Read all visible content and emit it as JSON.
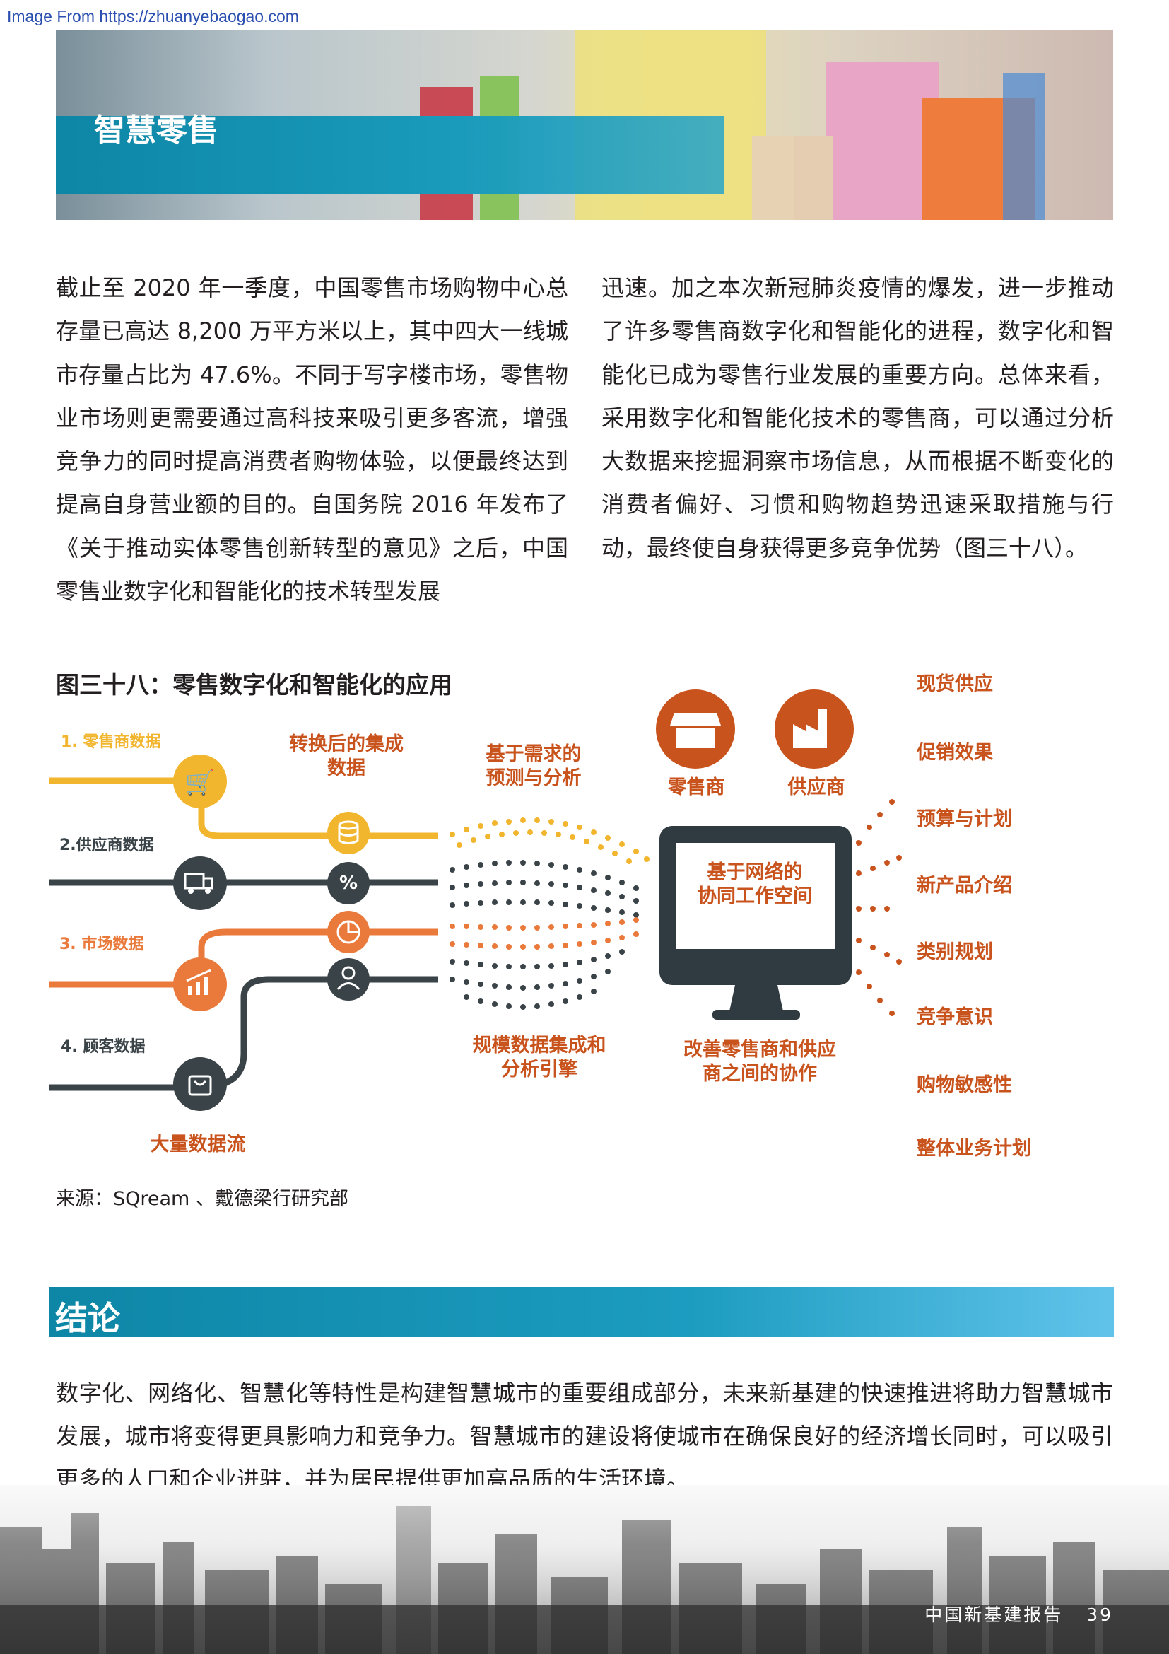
{
  "watermark": "Image From https://zhuanyebaogao.com",
  "hero": {
    "title": "智慧零售"
  },
  "body": {
    "left": "截止至 2020 年一季度，中国零售市场购物中心总存量已高达 8,200 万平方米以上，其中四大一线城市存量占比为 47.6%。不同于写字楼市场，零售物业市场则更需要通过高科技来吸引更多客流，增强竞争力的同时提高消费者购物体验，以便最终达到提高自身营业额的目的。自国务院 2016 年发布了《关于推动实体零售创新转型的意见》之后，中国零售业数字化和智能化的技术转型发展",
    "right": "迅速。加之本次新冠肺炎疫情的爆发，进一步推动了许多零售商数字化和智能化的进程，数字化和智能化已成为零售行业发展的重要方向。总体来看，采用数字化和智能化技术的零售商，可以通过分析大数据来挖掘洞察市场信息，从而根据不断变化的消费者偏好、习惯和购物趋势迅速采取措施与行动，最终使自身获得更多竞争优势（图三十八）。"
  },
  "figure": {
    "title": "图三十八：零售数字化和智能化的应用",
    "sources": {
      "retailer": "1. 零售商数据",
      "supplier": "2.供应商数据",
      "market": "3. 市场数据",
      "customer": "4. 顾客数据"
    },
    "converted": "转换后的集成\n数据",
    "forecast": "基于需求的\n预测与分析",
    "big_data_flow": "大量数据流",
    "engine": "规模数据集成和\n分析引擎",
    "collab": "改善零售商和供应\n商之间的协作",
    "retailer_label": "零售商",
    "supplier_label": "供应商",
    "percent_symbol": "%",
    "screen_text": "基于网络的\n协同工作空间",
    "outcomes": [
      "现货供应",
      "促销效果",
      "预算与计划",
      "新产品介绍",
      "类别规划",
      "竞争意识",
      "购物敏感性",
      "整体业务计划"
    ],
    "source": "来源：SQream 、戴德梁行研究部"
  },
  "conclusion": {
    "title": "结论",
    "body": "数字化、网络化、智慧化等特性是构建智慧城市的重要组成部分，未来新基建的快速推进将助力智慧城市发展，城市将变得更具影响力和竞争力。智慧城市的建设将使城市在确保良好的经济增长同时，可以吸引更多的人口和企业进驻，并为居民提供更加高品质的生活环境。"
  },
  "footer": {
    "report": "中国新基建报告",
    "page": "39"
  },
  "colors": {
    "teal": "#0e86a6",
    "orange": "#c9531d",
    "yellow": "#f1b52e",
    "dark": "#3a4347",
    "coral": "#ea7a3b"
  }
}
